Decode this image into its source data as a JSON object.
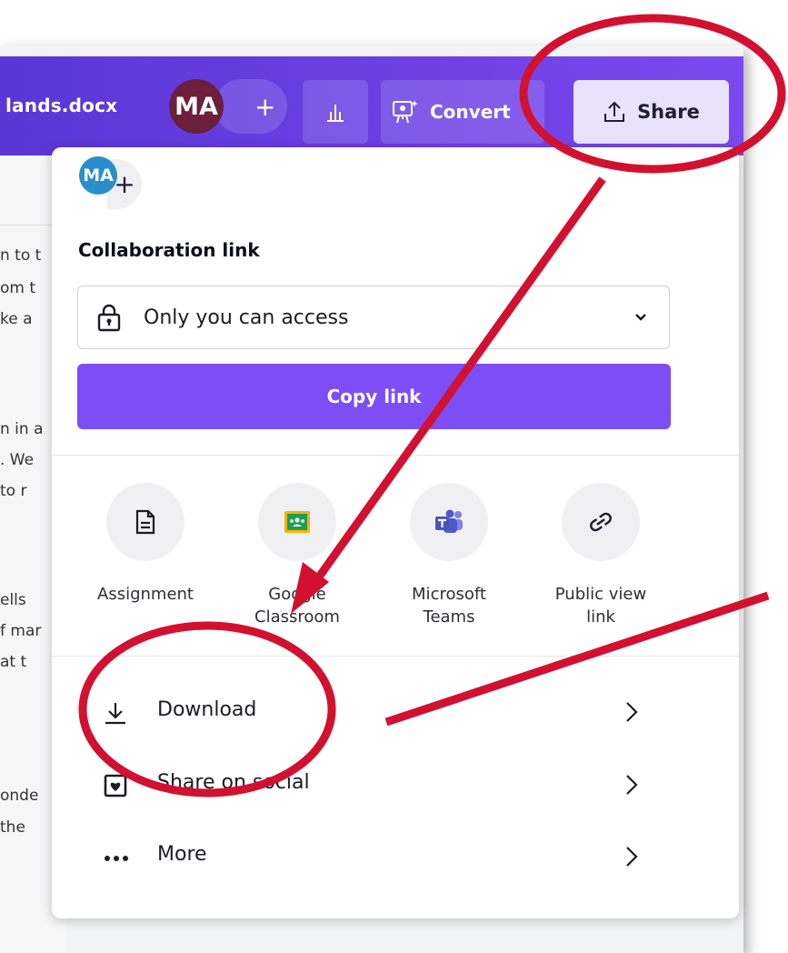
{
  "header": {
    "filename": "lands.docx",
    "avatar_initials": "MA",
    "add_symbol": "+",
    "convert_label": "Convert",
    "share_label": "Share"
  },
  "doc": {
    "lines": [
      "n to t",
      "om t",
      "ke a",
      "n in a",
      ". We",
      "to r",
      "ells",
      "f mar",
      "at t",
      "onde",
      "the"
    ]
  },
  "share_panel": {
    "avatar_initials": "MA",
    "add_symbol": "+",
    "collab_title": "Collaboration link",
    "access_value": "Only you can access",
    "copy_link_label": "Copy link",
    "options": [
      {
        "label": "Assignment",
        "icon": "document-icon"
      },
      {
        "label": "Google Classroom",
        "icon": "google-classroom-icon"
      },
      {
        "label": "Microsoft Teams",
        "icon": "microsoft-teams-icon"
      },
      {
        "label": "Public view link",
        "icon": "link-icon"
      }
    ],
    "rows": [
      {
        "label": "Download",
        "icon": "download-icon"
      },
      {
        "label": "Share on social",
        "icon": "social-icon"
      },
      {
        "label": "More",
        "icon": "more-icon"
      }
    ]
  },
  "colors": {
    "header_purple": "#6a40e6",
    "copy_button": "#7d4df6",
    "annotation_red": "#d2102f"
  }
}
